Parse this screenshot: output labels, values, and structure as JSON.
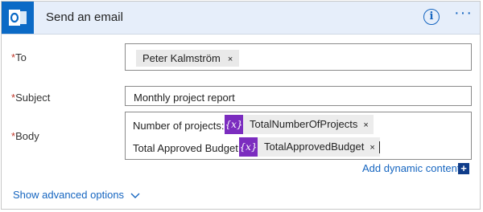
{
  "header": {
    "title": "Send an email",
    "info_symbol": "i",
    "more_symbol": "···",
    "brand_color": "#0b6ac6",
    "icons": [
      "outlook-icon",
      "info-icon",
      "more-icon"
    ]
  },
  "fields": {
    "to": {
      "required_mark": "*",
      "label": "To",
      "recipient": "Peter Kalmström",
      "remove_symbol": "×"
    },
    "subject": {
      "required_mark": "*",
      "label": "Subject",
      "value": "Monthly project report"
    },
    "body": {
      "required_mark": "*",
      "label": "Body",
      "lines": [
        {
          "text": "Number of projects:",
          "token": "TotalNumberOfProjects"
        },
        {
          "text": "Total Approved Budget:",
          "token": "TotalApprovedBudget"
        }
      ],
      "token_icon_text": "{x}",
      "remove_symbol": "×",
      "token_color": "#7b2cbf"
    }
  },
  "add_dynamic_content": {
    "label": "Add dynamic content",
    "icon_symbol": "+"
  },
  "show_advanced": {
    "label": "Show advanced options"
  },
  "accent_color": "#1565c0"
}
